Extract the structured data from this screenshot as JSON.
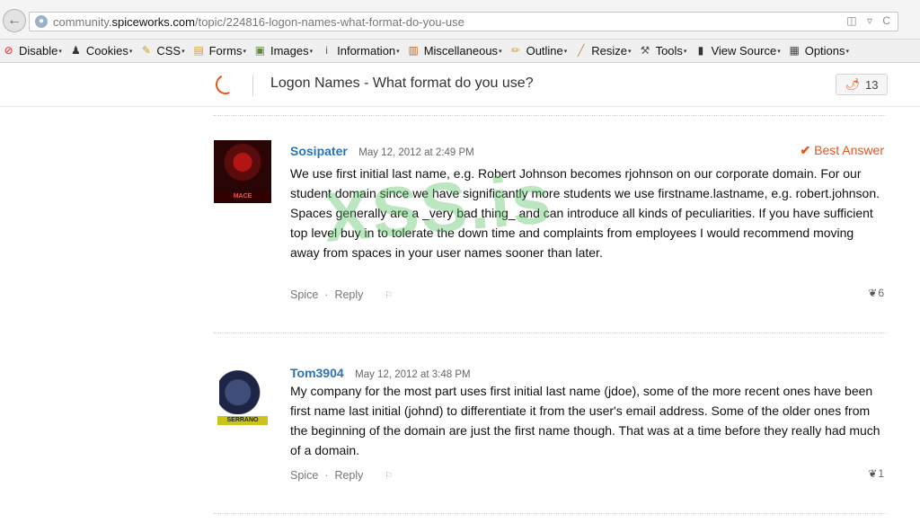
{
  "browser": {
    "url_prefix": "community.",
    "url_domain": "spiceworks.com",
    "url_path": "/topic/224816-logon-names-what-format-do-you-use"
  },
  "devtoolbar": {
    "items": [
      {
        "label": "Disable",
        "icon": "disable-icon",
        "color": "#d22"
      },
      {
        "label": "Cookies",
        "icon": "cookies-icon",
        "color": "#333"
      },
      {
        "label": "CSS",
        "icon": "css-icon",
        "color": "#c9a21e"
      },
      {
        "label": "Forms",
        "icon": "forms-icon",
        "color": "#d39b2b"
      },
      {
        "label": "Images",
        "icon": "images-icon",
        "color": "#5a8a3a"
      },
      {
        "label": "Information",
        "icon": "information-icon",
        "color": "#2a66c0"
      },
      {
        "label": "Miscellaneous",
        "icon": "miscellaneous-icon",
        "color": "#c1682a"
      },
      {
        "label": "Outline",
        "icon": "outline-icon",
        "color": "#d9a531"
      },
      {
        "label": "Resize",
        "icon": "resize-icon",
        "color": "#c08c4a"
      },
      {
        "label": "Tools",
        "icon": "tools-icon",
        "color": "#555"
      },
      {
        "label": "View Source",
        "icon": "view-source-icon",
        "color": "#333"
      },
      {
        "label": "Options",
        "icon": "options-icon",
        "color": "#444"
      }
    ]
  },
  "header": {
    "topic_title": "Logon Names - What format do you use?",
    "spice_count": "13"
  },
  "watermark": "XSS.is",
  "posts": [
    {
      "username": "Sosipater",
      "date": "May 12, 2012 at 2:49 PM",
      "best_answer": "Best Answer",
      "avatar_tag": "MACE",
      "text": "We use first initial last name, e.g. Robert Johnson becomes rjohnson on our corporate domain. For our student domain since we have significantly more students we use firstname.lastname, e.g. robert.johnson. Spaces generally are a _very bad thing_ and can introduce all kinds of peculiarities. If you have sufficient top level buy in to tolerate the down time and complaints from employees I would recommend moving away from spaces in your user names sooner than later.",
      "spice_label": "Spice",
      "reply_label": "Reply",
      "spice_count": "6"
    },
    {
      "username": "Tom3904",
      "date": "May 12, 2012 at 3:48 PM",
      "avatar_tag": "SERRANO",
      "text": "My company for the most part uses first initial last name (jdoe), some of the more recent ones have been first name last initial (johnd) to differentiate it from the user's email address. Some of the older ones from the beginning of the domain are just the first name though. That was at a time before they really had much of a domain.",
      "spice_label": "Spice",
      "reply_label": "Reply",
      "spice_count": "1"
    }
  ]
}
